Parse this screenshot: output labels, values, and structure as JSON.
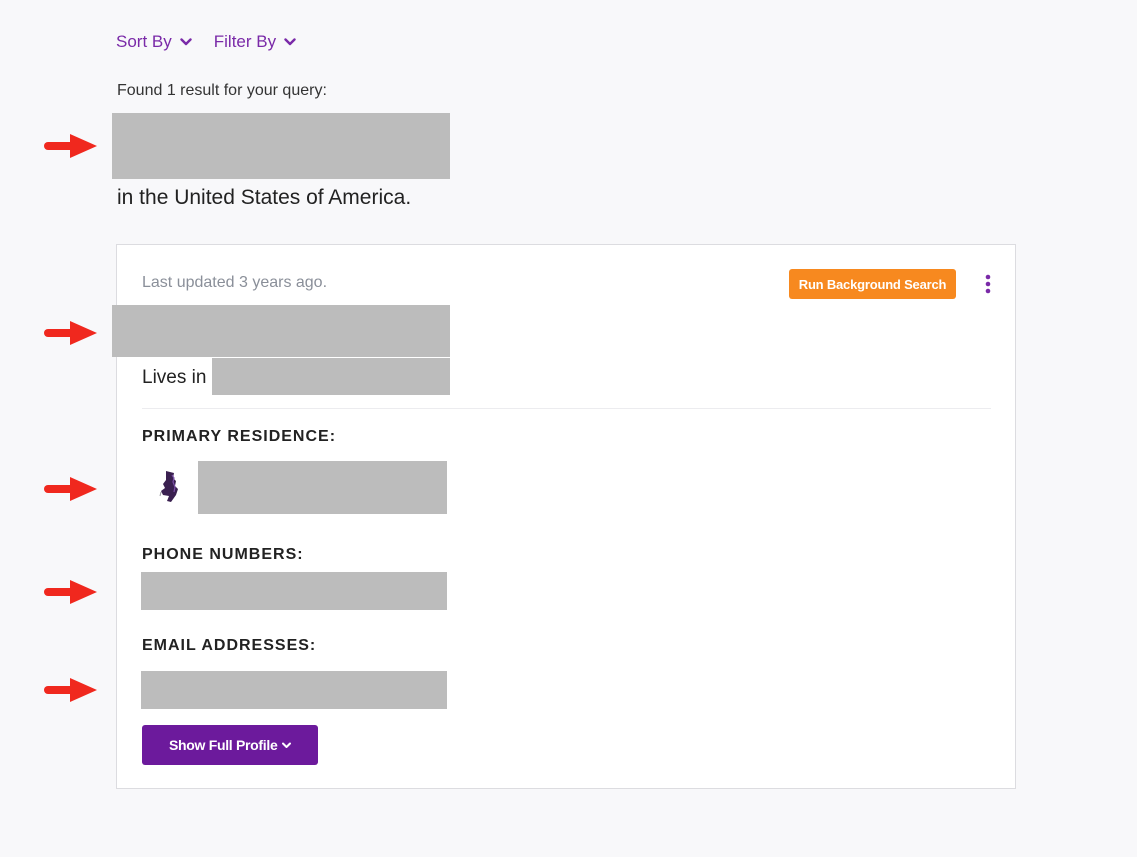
{
  "toolbar": {
    "sort_label": "Sort By",
    "filter_label": "Filter By"
  },
  "results": {
    "found_text": "Found 1 result for your query:",
    "location_text": "in the United States of America."
  },
  "card": {
    "last_updated": "Last updated 3 years ago.",
    "run_search_label": "Run Background Search",
    "lives_in_label": "Lives in",
    "primary_residence_heading": "PRIMARY RESIDENCE:",
    "phone_numbers_heading": "PHONE NUMBERS:",
    "email_addresses_heading": "EMAIL ADDRESSES:",
    "show_profile_label": "Show Full Profile"
  },
  "icons": {
    "dropdown": "chevron-down-icon",
    "menu": "kebab-menu-icon",
    "state": "state-map-icon",
    "annotation": "red-arrow-icon"
  },
  "colors": {
    "accent_purple": "#6c1a9c",
    "link_purple": "#7a2aa8",
    "orange": "#f7891f",
    "redaction": "#bcbcbc",
    "arrow_red": "#f0281e"
  }
}
